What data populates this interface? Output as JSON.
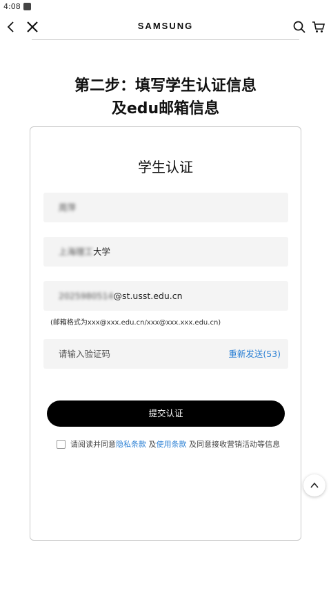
{
  "status_bar": {
    "time": "4:08"
  },
  "header": {
    "brand": "SAMSUNG",
    "icons": [
      "back-icon",
      "close-icon",
      "search-icon",
      "cart-icon"
    ]
  },
  "page": {
    "step_title_line1": "第二步：填写学生认证信息",
    "step_title_line2": "及edu邮箱信息"
  },
  "form": {
    "title": "学生认证",
    "name_value": "周萍",
    "school_blurred": "上海理工",
    "school_suffix": "大学",
    "email_blurred": "2025980514",
    "email_domain": "@st.usst.edu.cn",
    "email_hint": "(邮箱格式为xxx@xxx.edu.cn/xxx@xxx.xxx.edu.cn)",
    "code_placeholder": "请输入验证码",
    "resend_label": "重新发送(53)",
    "submit_label": "提交认证",
    "agree_prefix": "请阅读并同意",
    "privacy_link": "隐私条款",
    "and_1": " 及",
    "terms_link": "使用条款",
    "agree_suffix": " 及同意接收营销活动等信息"
  },
  "colors": {
    "link": "#2a7fd4",
    "button": "#000000",
    "field_bg": "#f4f4f4"
  }
}
